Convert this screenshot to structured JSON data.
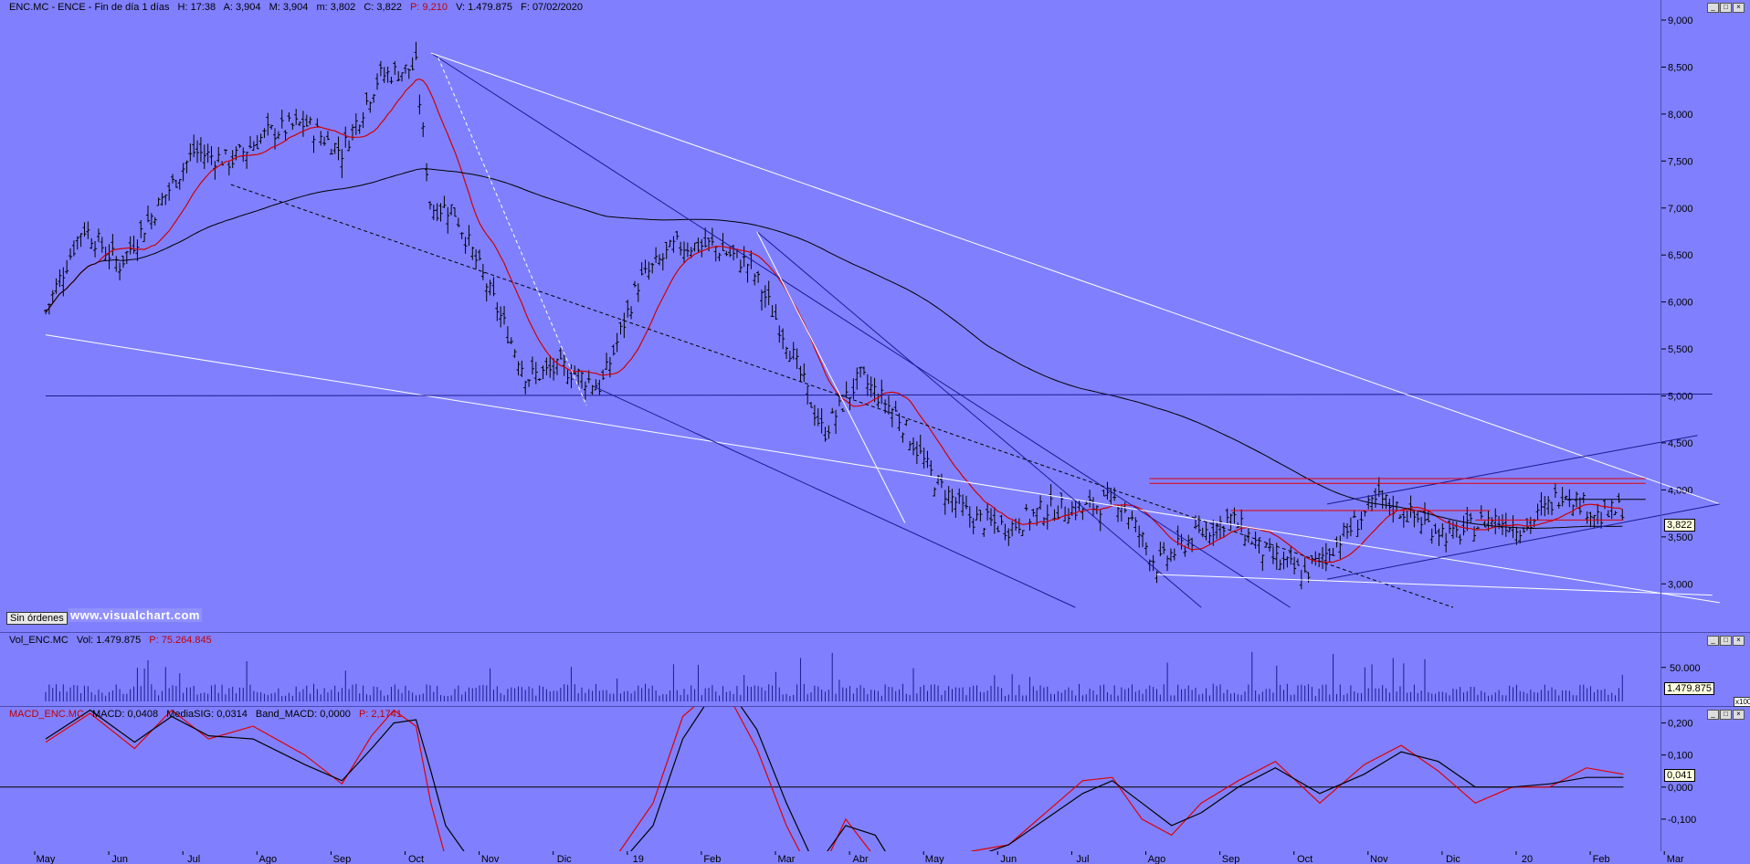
{
  "header": {
    "symbol": "ENC.MC - ENCE - Fin de día 1 días",
    "high": "H: 17:38",
    "open": "A: 3,904",
    "max": "M: 3,904",
    "min": "m: 3,802",
    "close": "C: 3,822",
    "per": "P: 9,210",
    "volume": "V: 1.479.875",
    "date": "F: 07/02/2020"
  },
  "volume_header": {
    "label": "Vol_ENC.MC",
    "value": "Vol: 1.479.875",
    "per": "P: 75.264.845"
  },
  "macd_header": {
    "label": "MACD_ENC.MC",
    "macd": "MACD: 0,0408",
    "signal": "MediaSIG: 0,0314",
    "band": "Band_MACD: 0,0000",
    "per": "P: 2,1741"
  },
  "badges": {
    "price": "3,822",
    "volume": "1.479.875",
    "macd": "0,041",
    "vol_scale": "x100"
  },
  "buttons": {
    "sin_ordenes": "Sin órdenes"
  },
  "watermark": "www.visualchart.com",
  "colors": {
    "background": "#8080ff",
    "candles": "#000000",
    "ma_short": "#d00000",
    "ma_long": "#000000",
    "trend_white": "#ffffff",
    "trend_blue": "#1a1a90",
    "resistance_red": "#e00000"
  },
  "chart_data": [
    {
      "type": "candlestick",
      "title": "ENC.MC - ENCE",
      "ylim": [
        2.75,
        9.0
      ],
      "y_ticks": [
        "9,000",
        "8,500",
        "8,000",
        "7,500",
        "7,000",
        "6,500",
        "6,000",
        "5,500",
        "5,000",
        "4,500",
        "4,000",
        "3,500",
        "3,000"
      ],
      "y_tick_values": [
        9.0,
        8.5,
        8.0,
        7.5,
        7.0,
        6.5,
        6.0,
        5.5,
        5.0,
        4.5,
        4.0,
        3.5,
        3.0
      ],
      "x_ticks": [
        "May",
        "Jun",
        "Jul",
        "Ago",
        "Sep",
        "Oct",
        "Nov",
        "Dic",
        "19",
        "Feb",
        "Mar",
        "Abr",
        "May",
        "Jun",
        "Jul",
        "Ago",
        "Sep",
        "Oct",
        "Nov",
        "Dic",
        "20",
        "Feb",
        "Mar"
      ],
      "x_tick_months": [
        0,
        1,
        2,
        3,
        4,
        5,
        6,
        7,
        8,
        9,
        10,
        11,
        12,
        13,
        14,
        15,
        16,
        17,
        18,
        19,
        20,
        21,
        22
      ],
      "close_series_monthly": {
        "months": [
          0,
          0.5,
          1,
          1.5,
          2,
          2.5,
          3,
          3.5,
          4,
          4.5,
          5,
          5.2,
          5.5,
          6,
          6.5,
          7,
          7.5,
          8,
          8.5,
          9,
          9.5,
          10,
          10.5,
          11,
          11.5,
          12,
          12.5,
          13,
          13.5,
          14,
          14.5,
          15,
          15.5,
          16,
          16.5,
          17,
          17.5,
          18,
          18.5,
          19,
          19.5,
          20,
          20.5,
          21,
          21.3
        ],
        "close": [
          5.9,
          6.8,
          6.4,
          7.0,
          7.6,
          7.5,
          7.8,
          7.9,
          7.6,
          8.4,
          8.5,
          7.0,
          7.0,
          6.1,
          5.2,
          5.3,
          5.1,
          6.2,
          6.6,
          6.6,
          6.4,
          5.6,
          4.6,
          5.2,
          4.8,
          4.1,
          3.7,
          3.6,
          3.8,
          3.8,
          3.9,
          3.2,
          3.5,
          3.7,
          3.3,
          3.1,
          3.5,
          3.9,
          3.7,
          3.5,
          3.7,
          3.6,
          4.0,
          3.7,
          3.82
        ]
      },
      "indicators": [
        "moving average (red)",
        "moving average (black)"
      ],
      "last_value": 3.822
    },
    {
      "type": "bar",
      "title": "Vol_ENC.MC",
      "y_ticks": [
        "50.000"
      ],
      "y_tick_values": [
        50000
      ],
      "last_value": 1479875
    },
    {
      "type": "line",
      "title": "MACD_ENC.MC",
      "ylim": [
        -0.2,
        0.25
      ],
      "y_ticks": [
        "0,200",
        "0,100",
        "0,000",
        "-0,100"
      ],
      "y_tick_values": [
        0.2,
        0.1,
        0.0,
        -0.1
      ],
      "series": [
        {
          "name": "MACD",
          "months": [
            0,
            0.6,
            1.2,
            1.7,
            2.2,
            2.8,
            3.5,
            4.0,
            4.4,
            4.7,
            5.0,
            5.2,
            5.4,
            5.8,
            6.3,
            7.0,
            7.6,
            8.2,
            8.6,
            9.0,
            9.3,
            9.6,
            10.0,
            10.4,
            10.8,
            11.2,
            11.6,
            12.0,
            12.5,
            13.0,
            13.5,
            14.0,
            14.4,
            14.8,
            15.2,
            15.6,
            16.1,
            16.6,
            17.2,
            17.8,
            18.3,
            18.8,
            19.3,
            19.8,
            20.3,
            20.8,
            21.3
          ],
          "values": [
            0.14,
            0.23,
            0.12,
            0.24,
            0.15,
            0.19,
            0.1,
            0.01,
            0.16,
            0.24,
            0.19,
            -0.05,
            -0.22,
            -0.3,
            -0.35,
            -0.33,
            -0.25,
            -0.05,
            0.22,
            0.3,
            0.25,
            0.12,
            -0.12,
            -0.3,
            -0.1,
            -0.22,
            -0.35,
            -0.28,
            -0.2,
            -0.18,
            -0.08,
            0.02,
            0.03,
            -0.1,
            -0.15,
            -0.05,
            0.02,
            0.08,
            -0.05,
            0.07,
            0.13,
            0.05,
            -0.05,
            0.0,
            0.0,
            0.06,
            0.04
          ]
        },
        {
          "name": "MediaSIG",
          "months": [
            0,
            0.6,
            1.2,
            1.7,
            2.2,
            2.8,
            3.5,
            4.0,
            4.4,
            4.7,
            5.0,
            5.2,
            5.4,
            5.8,
            6.3,
            7.0,
            7.6,
            8.2,
            8.6,
            9.0,
            9.3,
            9.6,
            10.0,
            10.4,
            10.8,
            11.2,
            11.6,
            12.0,
            12.5,
            13.0,
            13.5,
            14.0,
            14.4,
            14.8,
            15.2,
            15.6,
            16.1,
            16.6,
            17.2,
            17.8,
            18.3,
            18.8,
            19.3,
            19.8,
            20.3,
            20.8,
            21.3
          ],
          "values": [
            0.15,
            0.24,
            0.14,
            0.22,
            0.16,
            0.15,
            0.07,
            0.02,
            0.12,
            0.2,
            0.21,
            0.05,
            -0.12,
            -0.25,
            -0.33,
            -0.35,
            -0.28,
            -0.12,
            0.15,
            0.29,
            0.28,
            0.18,
            -0.05,
            -0.25,
            -0.12,
            -0.15,
            -0.3,
            -0.32,
            -0.22,
            -0.18,
            -0.1,
            -0.02,
            0.02,
            -0.05,
            -0.12,
            -0.08,
            0.0,
            0.06,
            -0.02,
            0.04,
            0.11,
            0.08,
            0.0,
            0.0,
            0.01,
            0.03,
            0.03
          ]
        }
      ],
      "last_value": 0.041
    }
  ]
}
